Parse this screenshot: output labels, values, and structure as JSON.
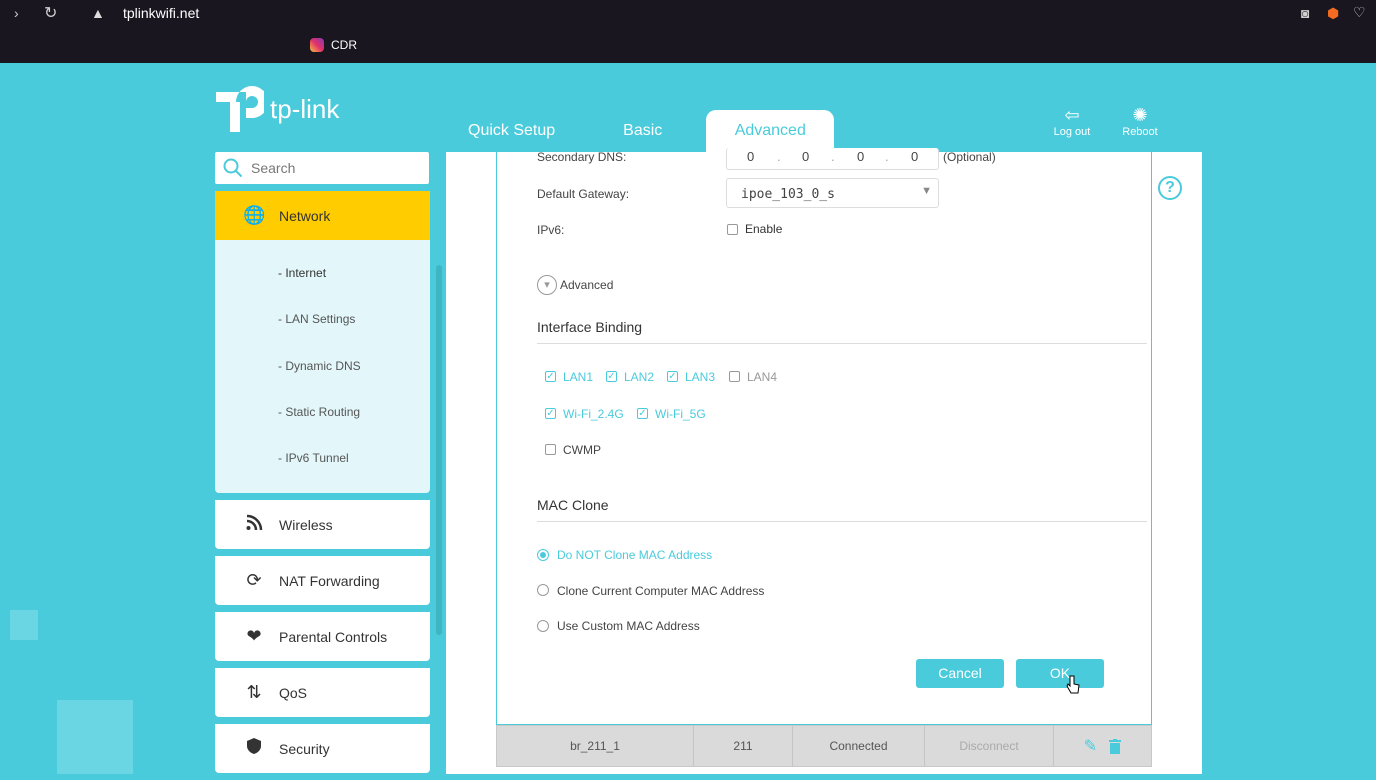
{
  "browser": {
    "url": "tplinkwifi.net",
    "bookmark": "CDR"
  },
  "logo": {
    "text": "tp-link"
  },
  "tabs": [
    "Quick Setup",
    "Basic",
    "Advanced"
  ],
  "top_buttons": {
    "logout": "Log out",
    "reboot": "Reboot"
  },
  "sidebar": {
    "search_placeholder": "Search",
    "network": "Network",
    "sub_items": [
      "- Internet",
      "- LAN Settings",
      "- Dynamic DNS",
      "- Static Routing",
      "- IPv6 Tunnel"
    ],
    "items": [
      "Wireless",
      "NAT Forwarding",
      "Parental Controls",
      "QoS",
      "Security"
    ]
  },
  "form": {
    "secondary_dns_label": "Secondary DNS:",
    "secondary_dns": [
      "0",
      "0",
      "0",
      "0"
    ],
    "secondary_dns_note": "(Optional)",
    "gateway_label": "Default Gateway:",
    "gateway_value": "ipoe_103_0_s",
    "ipv6_label": "IPv6:",
    "ipv6_enable": "Enable",
    "advanced_label": "Advanced",
    "interface_binding_title": "Interface Binding",
    "bindings": [
      {
        "label": "LAN1",
        "checked": true
      },
      {
        "label": "LAN2",
        "checked": true
      },
      {
        "label": "LAN3",
        "checked": true
      },
      {
        "label": "LAN4",
        "checked": false
      },
      {
        "label": "Wi-Fi_2.4G",
        "checked": true
      },
      {
        "label": "Wi-Fi_5G",
        "checked": true
      },
      {
        "label": "CWMP",
        "checked": false
      }
    ],
    "mac_clone_title": "MAC Clone",
    "mac_options": [
      {
        "label": "Do NOT Clone MAC Address",
        "selected": true
      },
      {
        "label": "Clone Current Computer MAC Address",
        "selected": false
      },
      {
        "label": "Use Custom MAC Address",
        "selected": false
      }
    ],
    "cancel": "Cancel",
    "ok": "OK"
  },
  "table_row": {
    "name": "br_211_1",
    "vlan": "211",
    "status": "Connected",
    "action": "Disconnect"
  },
  "colors": {
    "accent": "#4acbdb",
    "highlight": "#ffcc00"
  }
}
